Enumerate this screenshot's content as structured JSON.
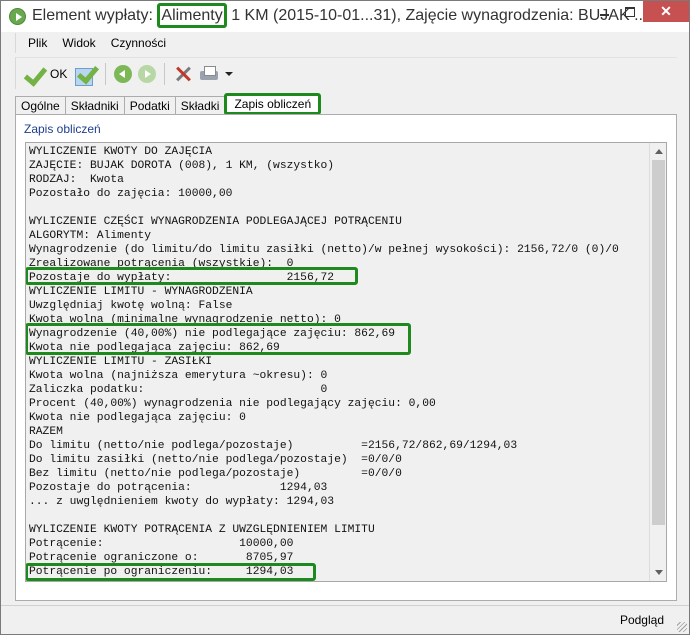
{
  "window": {
    "title_prefix": "Element wypłaty: ",
    "title_highlight": "Alimenty",
    "title_suffix": " 1 KM (2015-10-01...31), Zajęcie wynagrodzenia: BUJAK ..."
  },
  "menu": [
    "Plik",
    "Widok",
    "Czynności"
  ],
  "toolbar": {
    "ok_label": "OK"
  },
  "tabs": [
    "Ogólne",
    "Składniki",
    "Podatki",
    "Składki",
    "Zapis obliczeń"
  ],
  "active_tab": "Zapis obliczeń",
  "group_label": "Zapis obliczeń",
  "lines": [
    "WYLICZENIE KWOTY DO ZAJĘCIA",
    "ZAJĘCIE: BUJAK DOROTA (008), 1 KM, (wszystko)",
    "RODZAJ:  Kwota",
    "Pozostało do zajęcia: 10000,00",
    "",
    "WYLICZENIE CZĘŚCI WYNAGRODZENIA PODLEGAJĄCEJ POTRĄCENIU",
    "ALGORYTM: Alimenty",
    "Wynagrodzenie (do limitu/do limitu zasiłki (netto)/w pełnej wysokości): 2156,72/0 (0)/0",
    "Zrealizowane potrącenia (wszystkie):  0",
    "Pozostaje do wypłaty:                 2156,72",
    "WYLICZENIE LIMITU - WYNAGRODZENIA",
    "Uwzględniaj kwotę wolną: False",
    "Kwota wolna (minimalne wynagrodzenie netto): 0",
    "Wynagrodzenie (40,00%) nie podlegające zajęciu: 862,69",
    "Kwota nie podlegająca zajęciu: 862,69",
    "WYLICZENIE LIMITU - ZASIŁKI",
    "Kwota wolna (najniższa emerytura ~okresu): 0",
    "Zaliczka podatku:                          0",
    "Procent (40,00%) wynagrodzenia nie podlegający zajęciu: 0,00",
    "Kwota nie podlegająca zajęciu: 0",
    "RAZEM",
    "Do limitu (netto/nie podlega/pozostaje)          =2156,72/862,69/1294,03",
    "Do limitu zasiłki (netto/nie podlega/pozostaje)  =0/0/0",
    "Bez limitu (netto/nie podlega/pozostaje)         =0/0/0",
    "Pozostaje do potrącenia:             1294,03",
    "... z uwględnieniem kwoty do wypłaty: 1294,03",
    "",
    "WYLICZENIE KWOTY POTRĄCENIA Z UWZGLĘDNIENIEM LIMITU",
    "Potrącenie:                    10000,00",
    "Potrącenie ograniczone o:       8705,97",
    "Potrącenie po ograniczeniu:     1294,03"
  ],
  "status": {
    "text": "Podgląd"
  }
}
